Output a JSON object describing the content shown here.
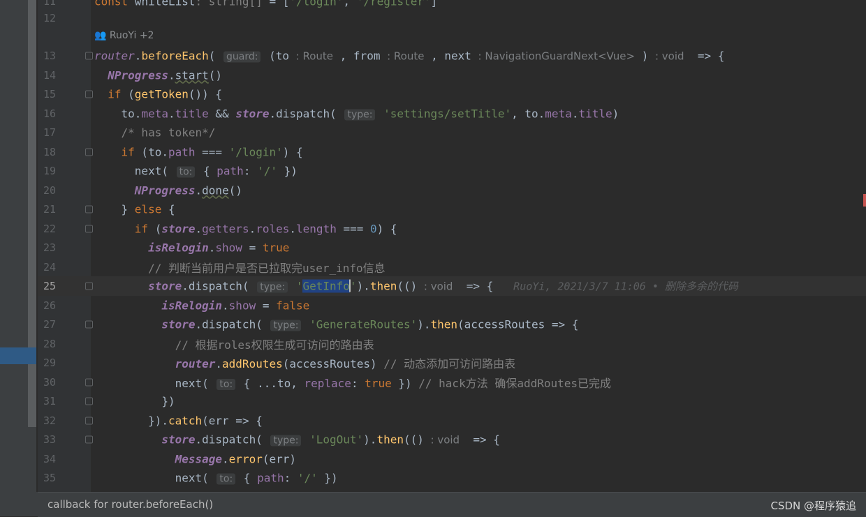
{
  "author_hint": "RuoYi +2",
  "lines": [
    {
      "n": "11",
      "html": "<span class=\"k\">const</span> whiteList<span class=\"c\">: string[]</span> = [<span class=\"s\">'/login'</span>, <span class=\"s\">'/register'</span>]"
    },
    {
      "n": "12",
      "html": ""
    },
    {
      "n": "13",
      "html": "<span class=\"pi\" style=\"font-weight:normal\">router</span>.<span class=\"f\">beforeEach</span>( <span class=\"hint\">guard:</span> (to <span class=\"thint\">: Route</span> , from <span class=\"thint\">: Route</span> , next <span class=\"thint\">: NavigationGuardNext&lt;Vue&gt;</span> ) <span class=\"thint\">: void</span>  =&gt; {"
    },
    {
      "n": "14",
      "html": "  <span class=\"pi\">NProgress</span>.<span class=\"ul\">start</span>()"
    },
    {
      "n": "15",
      "html": "  <span class=\"k\">if</span> (<span class=\"f\">getToken</span>()) {"
    },
    {
      "n": "16",
      "html": "    to.<span class=\"p\">meta</span>.<span class=\"p\">title</span> &amp;&amp; <span class=\"pi\">store</span>.dispatch( <span class=\"hint\">type:</span> <span class=\"s\">'settings/setTitle'</span>, to.<span class=\"p\">meta</span>.<span class=\"p\">title</span>)"
    },
    {
      "n": "17",
      "html": "    <span class=\"c\">/* has token*/</span>"
    },
    {
      "n": "18",
      "html": "    <span class=\"k\">if</span> (to.<span class=\"p\">path</span> === <span class=\"s\">'/login'</span>) {"
    },
    {
      "n": "19",
      "html": "      next( <span class=\"hint\">to:</span> { <span class=\"p\">path</span>: <span class=\"s\">'/'</span> })"
    },
    {
      "n": "20",
      "html": "      <span class=\"pi\">NProgress</span>.<span class=\"ul\">done</span>()"
    },
    {
      "n": "21",
      "html": "    } <span class=\"k\">else</span> {"
    },
    {
      "n": "22",
      "html": "      <span class=\"k\">if</span> (<span class=\"pi\">store</span>.<span class=\"p\">getters</span>.<span class=\"p\">roles</span>.<span class=\"p\">length</span> === <span class=\"nm\">0</span>) {"
    },
    {
      "n": "23",
      "html": "        <span class=\"pi\">isRelogin</span>.<span class=\"p\">show</span> = <span class=\"k\">true</span>"
    },
    {
      "n": "24",
      "html": "        <span class=\"c\">// 判断当前用户是否已拉取完user_info信息</span>"
    },
    {
      "n": "25",
      "html": "        <span class=\"pi\">store</span>.dispatch( <span class=\"hint\">type:</span> <span class=\"s\">'<span class=\"hl\">GetInfo</span>'</span>).<span class=\"f\">then</span>(() <span class=\"thint\">: void</span>  =&gt; {   <span class=\"blame\">RuoYi, 2021/3/7 11:06 • 删除多余的代码</span>"
    },
    {
      "n": "26",
      "html": "          <span class=\"pi\">isRelogin</span>.<span class=\"p\">show</span> = <span class=\"k\">false</span>"
    },
    {
      "n": "27",
      "html": "          <span class=\"pi\">store</span>.dispatch( <span class=\"hint\">type:</span> <span class=\"s\">'GenerateRoutes'</span>).<span class=\"f\">then</span>(accessRoutes =&gt; {"
    },
    {
      "n": "28",
      "html": "            <span class=\"c\">// 根据roles权限生成可访问的路由表</span>"
    },
    {
      "n": "29",
      "html": "            <span class=\"pi\">router</span>.<span class=\"f\">addRoutes</span>(accessRoutes) <span class=\"c\">// 动态添加可访问路由表</span>"
    },
    {
      "n": "30",
      "html": "            next( <span class=\"hint\">to:</span> { ...to, <span class=\"p\">replace</span>: <span class=\"k\">true</span> }) <span class=\"c\">// hack方法 确保addRoutes已完成</span>"
    },
    {
      "n": "31",
      "html": "          })"
    },
    {
      "n": "32",
      "html": "        }).<span class=\"f\">catch</span>(err =&gt; {"
    },
    {
      "n": "33",
      "html": "          <span class=\"pi\">store</span>.dispatch( <span class=\"hint\">type:</span> <span class=\"s\">'LogOut'</span>).<span class=\"f\">then</span>(() <span class=\"thint\">: void</span>  =&gt; {"
    },
    {
      "n": "34",
      "html": "            <span class=\"pi\">Message</span>.<span class=\"f\">error</span>(err)"
    },
    {
      "n": "35",
      "html": "            next( <span class=\"hint\">to:</span> { <span class=\"p\">path</span>: <span class=\"s\">'/'</span> })"
    }
  ],
  "status_text": "callback for router.beforeEach()",
  "watermark": "CSDN @程序猿追"
}
